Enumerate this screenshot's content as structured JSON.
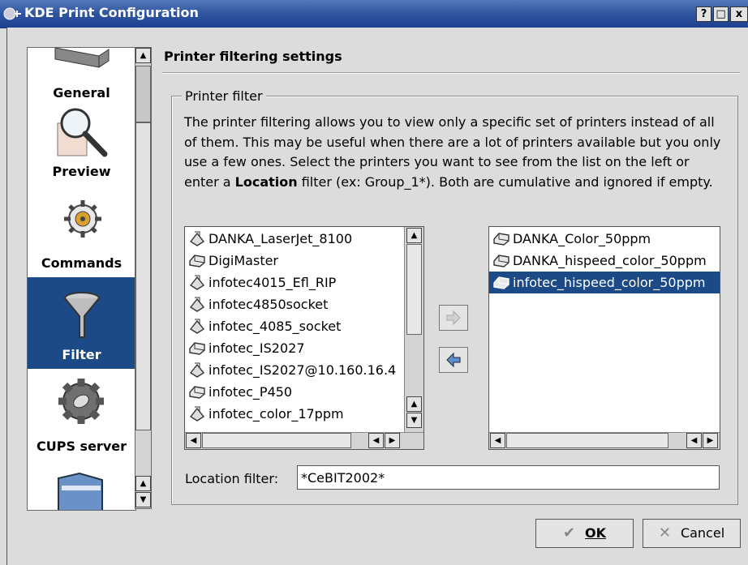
{
  "window": {
    "title": "KDE Print Configuration",
    "help_btn": "?",
    "max_btn": "□",
    "close_btn": "x"
  },
  "sidebar": {
    "items": [
      {
        "label": "General",
        "icon": "printer-icon"
      },
      {
        "label": "Preview",
        "icon": "magnifier-icon"
      },
      {
        "label": "Commands",
        "icon": "gear-icon"
      },
      {
        "label": "Filter",
        "icon": "funnel-icon"
      },
      {
        "label": "CUPS server",
        "icon": "cog-icon"
      },
      {
        "label": "",
        "icon": "folder-icon"
      }
    ],
    "selected": "Filter"
  },
  "page": {
    "title": "Printer filtering settings",
    "group_label": "Printer filter",
    "description_pre": "The printer filtering allows you to view only a specific set of printers instead of all of them. This may be useful when there are a lot of printers available but you only use a few ones. Select the printers you want to see from the list on the left or enter a ",
    "description_bold": "Location",
    "description_post": " filter (ex: Group_1*). Both are cumulative and ignored if empty."
  },
  "available_printers": [
    {
      "name": "DANKA_LaserJet_8100",
      "icon": "printer-remote-icon"
    },
    {
      "name": "DigiMaster",
      "icon": "printer-icon"
    },
    {
      "name": "infotec4015_Efl_RIP",
      "icon": "printer-remote-icon"
    },
    {
      "name": "infotec4850socket",
      "icon": "printer-remote-icon"
    },
    {
      "name": "infotec_4085_socket",
      "icon": "printer-remote-icon"
    },
    {
      "name": "infotec_IS2027",
      "icon": "printer-icon"
    },
    {
      "name": "infotec_IS2027@10.160.16.4",
      "icon": "printer-remote-icon"
    },
    {
      "name": "infotec_P450",
      "icon": "printer-icon"
    },
    {
      "name": "infotec_color_17ppm",
      "icon": "printer-remote-icon"
    }
  ],
  "selected_printers": [
    {
      "name": "DANKA_Color_50ppm",
      "icon": "printer-icon"
    },
    {
      "name": "DANKA_hispeed_color_50ppm",
      "icon": "printer-icon"
    },
    {
      "name": "infotec_hispeed_color_50ppm",
      "icon": "printer-icon",
      "selected": true
    }
  ],
  "location": {
    "label": "Location filter:",
    "value": "*CeBIT2002*"
  },
  "buttons": {
    "ok": "OK",
    "cancel": "Cancel"
  },
  "colors": {
    "selection": "#1c4a86",
    "titlebar": "#2f55a0"
  }
}
